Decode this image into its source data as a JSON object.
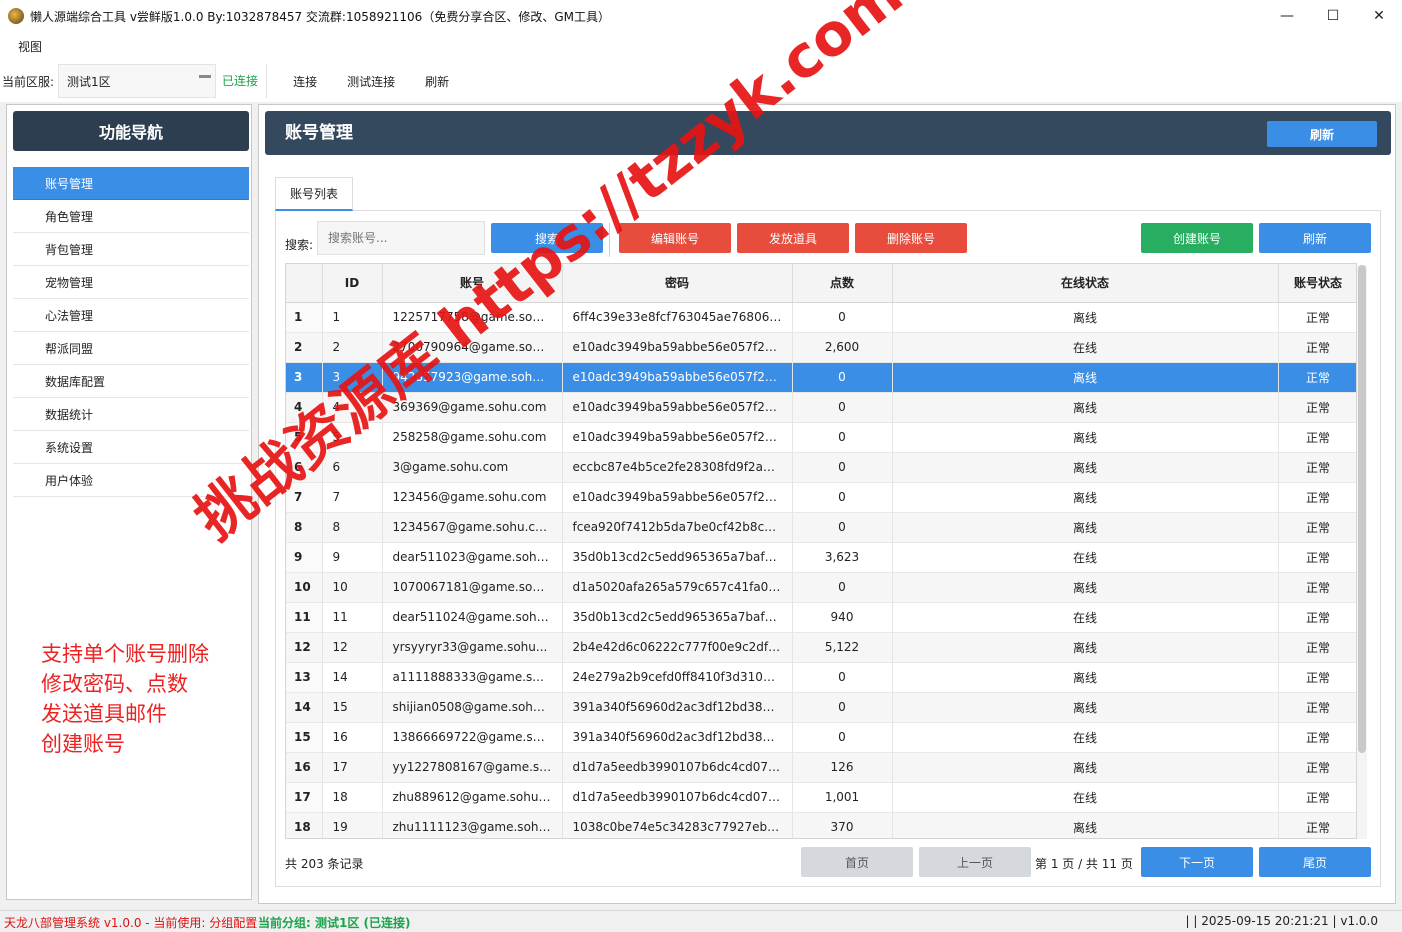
{
  "window": {
    "title": "懒人源端综合工具 v尝鲜版1.0.0 By:1032878457 交流群:1058921106（免费分享合区、修改、GM工具）",
    "controls": [
      "—",
      "☐",
      "✕"
    ]
  },
  "menu": {
    "view": "视图"
  },
  "toolbar": {
    "server_label": "当前区服:",
    "server_value": "测试1区",
    "status": "已连接",
    "connect": "连接",
    "test_connect": "测试连接",
    "refresh": "刷新"
  },
  "sidebar": {
    "title": "功能导航",
    "items": [
      "账号管理",
      "角色管理",
      "背包管理",
      "宠物管理",
      "心法管理",
      "帮派同盟",
      "数据库配置",
      "数据统计",
      "系统设置",
      "用户体验"
    ],
    "note": [
      "支持单个账号删除",
      "修改密码、点数",
      "发送道具邮件",
      "创建账号"
    ]
  },
  "main": {
    "title": "账号管理",
    "refresh": "刷新",
    "tab": "账号列表",
    "search_label": "搜索:",
    "search_placeholder": "搜索账号...",
    "btn_search": "搜索",
    "btn_edit": "编辑账号",
    "btn_send": "发放道具",
    "btn_delete": "删除账号",
    "btn_create": "创建账号",
    "btn_refresh": "刷新"
  },
  "table": {
    "columns": [
      "",
      "ID",
      "账号",
      "密码",
      "点数",
      "在线状态",
      "账号状态"
    ],
    "rows": [
      [
        "1",
        "1",
        "1225717758@game.sohu...",
        "6ff4c39e33e8fcf763045ae7680625...",
        "0",
        "离线",
        "正常"
      ],
      [
        "2",
        "2",
        "2700790964@game.sohu...",
        "e10adc3949ba59abbe56e057f20f...",
        "2,600",
        "在线",
        "正常"
      ],
      [
        "3",
        "3",
        "942857923@game.sohu....",
        "e10adc3949ba59abbe56e057f20f...",
        "0",
        "离线",
        "正常"
      ],
      [
        "4",
        "4",
        "369369@game.sohu.com",
        "e10adc3949ba59abbe56e057f20f...",
        "0",
        "离线",
        "正常"
      ],
      [
        "5",
        "5",
        "258258@game.sohu.com",
        "e10adc3949ba59abbe56e057f20f...",
        "0",
        "离线",
        "正常"
      ],
      [
        "6",
        "6",
        "3@game.sohu.com",
        "eccbc87e4b5ce2fe28308fd9f2a7b...",
        "0",
        "离线",
        "正常"
      ],
      [
        "7",
        "7",
        "123456@game.sohu.com",
        "e10adc3949ba59abbe56e057f20f...",
        "0",
        "离线",
        "正常"
      ],
      [
        "8",
        "8",
        "1234567@game.sohu.com",
        "fcea920f7412b5da7be0cf42b8c93...",
        "0",
        "离线",
        "正常"
      ],
      [
        "9",
        "9",
        "dear511023@game.sohu...",
        "35d0b13cd2c5edd965365a7bafb...",
        "3,623",
        "在线",
        "正常"
      ],
      [
        "10",
        "10",
        "1070067181@game.sohu...",
        "d1a5020afa265a579c657c41fa0d...",
        "0",
        "离线",
        "正常"
      ],
      [
        "11",
        "11",
        "dear511024@game.sohu...",
        "35d0b13cd2c5edd965365a7bafb...",
        "940",
        "在线",
        "正常"
      ],
      [
        "12",
        "12",
        "yrsyyryr33@game.sohu...",
        "2b4e42d6c06222c777f00e9c2dfd...",
        "5,122",
        "离线",
        "正常"
      ],
      [
        "13",
        "14",
        "a1111888333@game.s...",
        "24e279a2b9cefd0ff8410f3d310d4...",
        "0",
        "离线",
        "正常"
      ],
      [
        "14",
        "15",
        "shijian0508@game.sohu...",
        "391a340f56960d2ac3df12bd3834...",
        "0",
        "离线",
        "正常"
      ],
      [
        "15",
        "16",
        "13866669722@game.soh...",
        "391a340f56960d2ac3df12bd3834...",
        "0",
        "在线",
        "正常"
      ],
      [
        "16",
        "17",
        "yy1227808167@game.so...",
        "d1d7a5eedb3990107b6dc4cd078...",
        "126",
        "离线",
        "正常"
      ],
      [
        "17",
        "18",
        "zhu889612@game.sohu....",
        "d1d7a5eedb3990107b6dc4cd078...",
        "1,001",
        "在线",
        "正常"
      ],
      [
        "18",
        "19",
        "zhu1111123@game.sohu...",
        "1038c0be74e5c34283c77927eb44...",
        "370",
        "离线",
        "正常"
      ]
    ],
    "selected_row": 2
  },
  "pager": {
    "total": "共 203 条记录",
    "first": "首页",
    "prev": "上一页",
    "info": "第 1 页 / 共 11 页",
    "next": "下一页",
    "last": "尾页"
  },
  "statusbar": {
    "left": "天龙八部管理系统 v1.0.0 - 当前使用: 分组配置",
    "group": "当前分组: 测试1区 (已连接)",
    "right": "| | 2025-09-15 20:21:21 | v1.0.0"
  },
  "watermark": "挑战资源库 https://tzzyk.com",
  "colors": {
    "accent": "#3a8ee6",
    "header_dark": "#34495e",
    "danger": "#e74c3c",
    "success": "#27ae60"
  }
}
